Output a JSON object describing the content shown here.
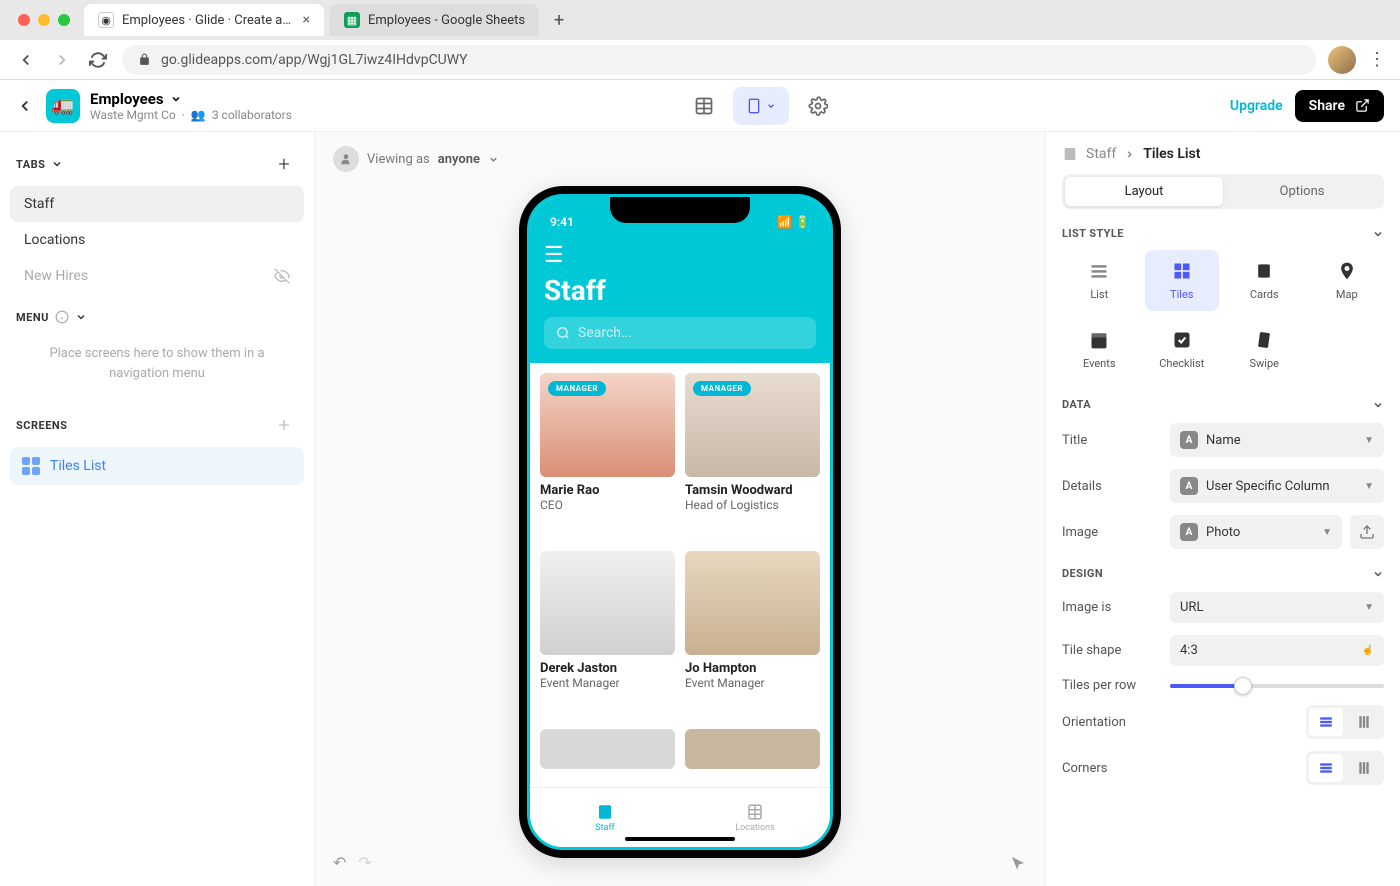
{
  "browser": {
    "tabs": [
      {
        "title": "Employees · Glide · Create apps",
        "favicon_bg": "#fff"
      },
      {
        "title": "Employees - Google Sheets",
        "favicon_bg": "#0f9d58"
      }
    ],
    "url": "go.glideapps.com/app/Wgj1GL7iwz4IHdvpCUWY"
  },
  "app_header": {
    "name": "Employees",
    "org": "Waste Mgmt Co",
    "collaborators": "3 collaborators",
    "upgrade": "Upgrade",
    "share": "Share"
  },
  "left": {
    "tabs_label": "TABS",
    "menu_label": "MENU",
    "screens_label": "SCREENS",
    "tabs": [
      {
        "label": "Staff",
        "active": true
      },
      {
        "label": "Locations"
      },
      {
        "label": "New Hires",
        "muted": true
      }
    ],
    "menu_placeholder": "Place screens here to show them in a navigation menu",
    "screen_item": "Tiles List"
  },
  "canvas": {
    "viewing_label": "Viewing as",
    "viewing_value": "anyone"
  },
  "phone": {
    "time": "9:41",
    "title": "Staff",
    "search_placeholder": "Search...",
    "tabs": [
      "Staff",
      "Locations"
    ],
    "tiles": [
      {
        "name": "Marie Rao",
        "role": "CEO",
        "badge": "MANAGER",
        "bg": "#e8b4a0"
      },
      {
        "name": "Tamsin Woodward",
        "role": "Head of Logistics",
        "badge": "MANAGER",
        "bg": "#d4c5b9"
      },
      {
        "name": "Derek Jaston",
        "role": "Event Manager",
        "bg": "#e0e0e0"
      },
      {
        "name": "Jo Hampton",
        "role": "Event Manager",
        "bg": "#d9c9b8"
      },
      {
        "name": "",
        "role": "",
        "bg": "#cfcfcf"
      },
      {
        "name": "",
        "role": "",
        "bg": "#b8a890"
      }
    ]
  },
  "right": {
    "crumb_parent": "Staff",
    "crumb_current": "Tiles List",
    "seg_layout": "Layout",
    "seg_options": "Options",
    "list_style_label": "LIST STYLE",
    "styles": [
      "List",
      "Tiles",
      "Cards",
      "Map",
      "Events",
      "Checklist",
      "Swipe"
    ],
    "data_label": "DATA",
    "data_rows": {
      "title_label": "Title",
      "title_value": "Name",
      "details_label": "Details",
      "details_value": "User Specific Column",
      "image_label": "Image",
      "image_value": "Photo"
    },
    "design_label": "DESIGN",
    "design_rows": {
      "image_is_label": "Image is",
      "image_is_value": "URL",
      "tile_shape_label": "Tile shape",
      "tile_shape_value": "4:3",
      "tiles_per_row_label": "Tiles per row",
      "orientation_label": "Orientation",
      "corners_label": "Corners"
    }
  }
}
